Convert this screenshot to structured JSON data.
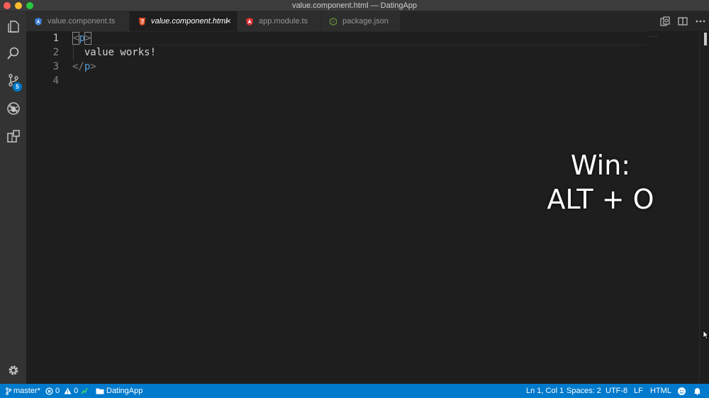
{
  "window": {
    "title": "value.component.html — DatingApp"
  },
  "activity_bar": {
    "source_control_badge": "5"
  },
  "tabs": [
    {
      "label": "value.component.ts",
      "icon": "angular-ts-icon",
      "active": false
    },
    {
      "label": "value.component.html",
      "icon": "html5-icon",
      "active": true,
      "close": "×"
    },
    {
      "label": "app.module.ts",
      "icon": "angular-icon",
      "active": false
    },
    {
      "label": "package.json",
      "icon": "nodejs-icon",
      "active": false
    }
  ],
  "editor": {
    "line_numbers": [
      "1",
      "2",
      "3",
      "4"
    ],
    "lines": [
      {
        "open": "<",
        "tag": "p",
        "close": ">"
      },
      {
        "text": "  value works!"
      },
      {
        "open": "</",
        "tag": "p",
        "close": ">"
      },
      {
        "text": ""
      }
    ],
    "minimap_dots": "...."
  },
  "overlay": {
    "line1": "Win:",
    "line2": "ALT + O"
  },
  "status_bar": {
    "branch": "master*",
    "errors": "0",
    "warnings": "0",
    "folder": "DatingApp",
    "position": "Ln 1, Col 1",
    "spaces": "Spaces: 2",
    "encoding": "UTF-8",
    "eol": "LF",
    "language": "HTML"
  },
  "colors": {
    "accent": "#007acc",
    "tag": "#569cd6",
    "editor_bg": "#1e1e1e"
  }
}
